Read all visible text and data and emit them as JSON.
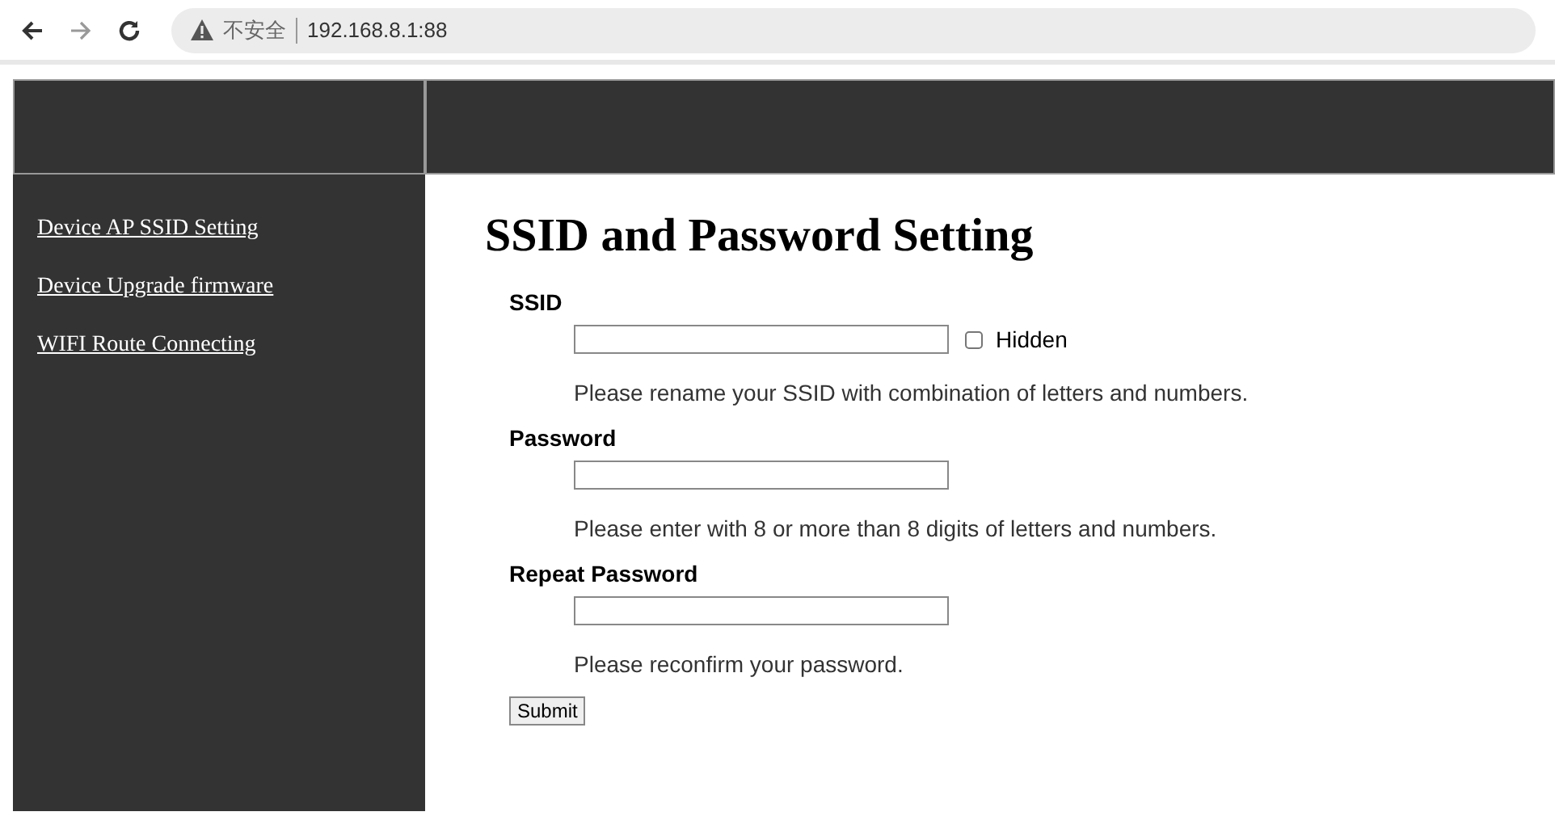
{
  "browser": {
    "security_label": "不安全",
    "url": "192.168.8.1:88"
  },
  "sidebar": {
    "items": [
      {
        "label": "Device AP SSID Setting"
      },
      {
        "label": "Device Upgrade firmware"
      },
      {
        "label": "WIFI Route Connecting"
      }
    ]
  },
  "main": {
    "title": "SSID and Password Setting",
    "fields": [
      {
        "label": "SSID",
        "checkbox": {
          "label": "Hidden",
          "checked": false
        },
        "hint": "Please rename your SSID with combination of letters and numbers."
      },
      {
        "label": "Password",
        "hint": "Please enter with 8 or more than 8 digits of letters and numbers."
      },
      {
        "label": "Repeat Password",
        "hint": "Please reconfirm your password."
      }
    ],
    "submit": "Submit"
  }
}
